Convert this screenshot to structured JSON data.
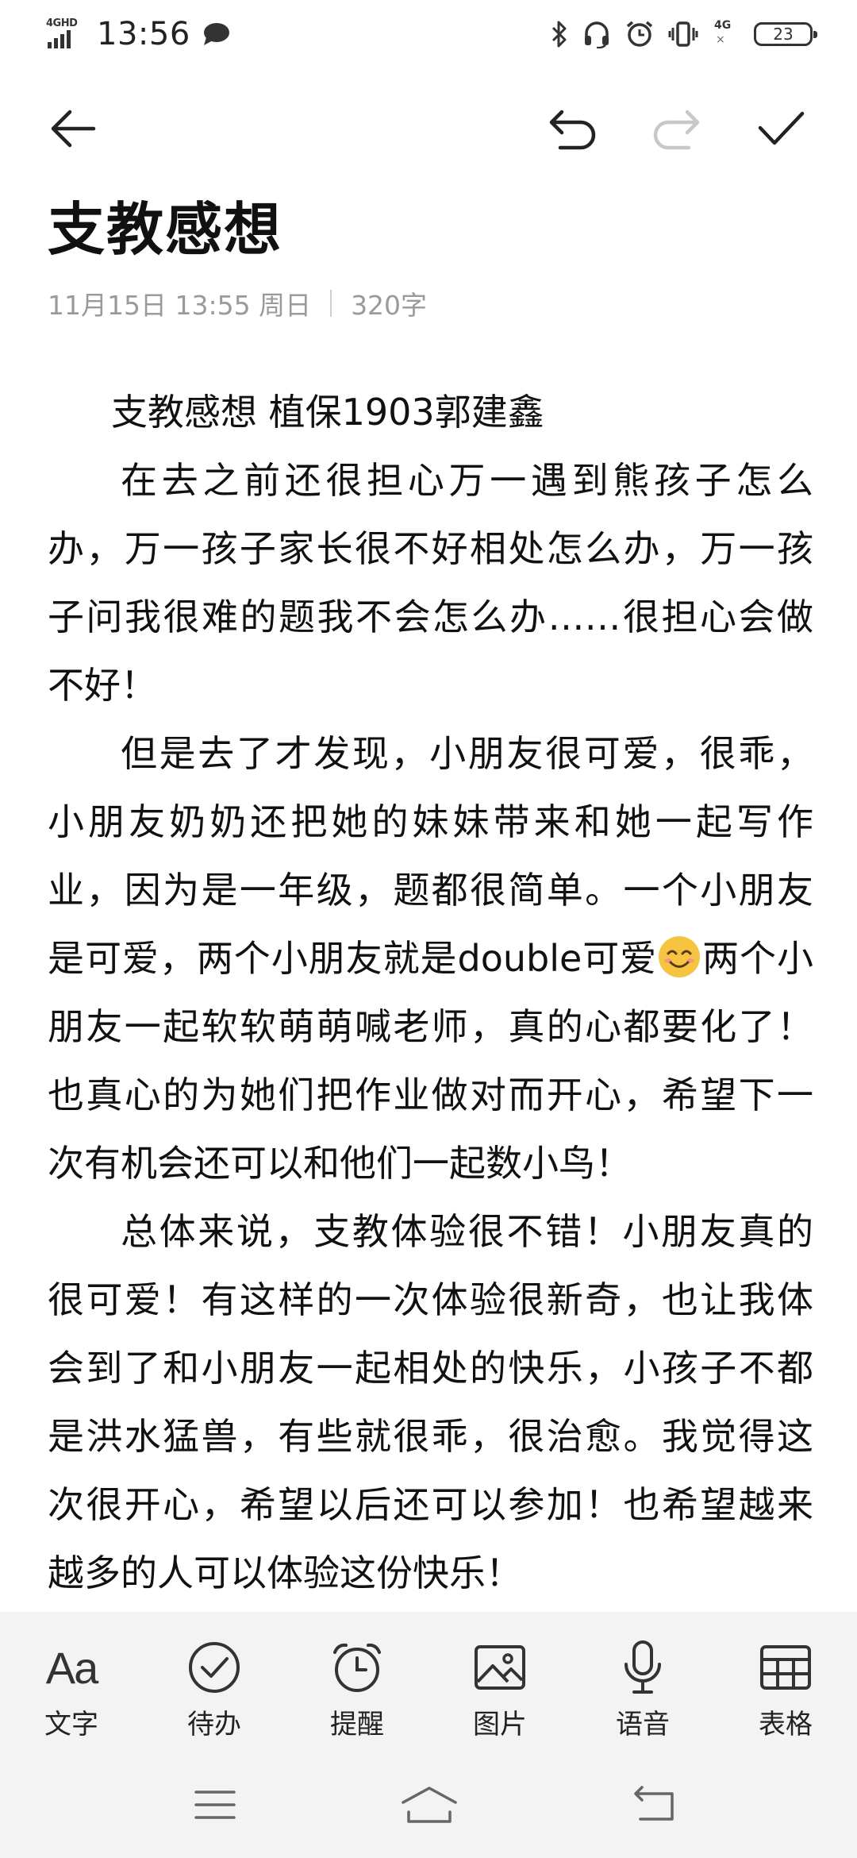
{
  "status_bar": {
    "network": "4GHD",
    "time": "13:56",
    "network2": "4G",
    "battery": "23"
  },
  "note": {
    "title": "支教感想",
    "date": "11月15日 13:55 周日",
    "word_count": "320字",
    "paragraphs": [
      "支教感想  植保1903郭建鑫",
      "在去之前还很担心万一遇到熊孩子怎么办，万一孩子家长很不好相处怎么办，万一孩子问我很难的题我不会怎么办……很担心会做不好！",
      "但是去了才发现，小朋友很可爱，很乖，小朋友奶奶还把她的妹妹带来和她一起写作业，因为是一年级，题都很简单。一个小朋友是可爱，两个小朋友就是double可爱",
      "两个小朋友一起软软萌萌喊老师，真的心都要化了！也真心的为她们把作业做对而开心，希望下一次有机会还可以和他们一起数小鸟！",
      "总体来说，支教体验很不错！小朋友真的很可爱！有这样的一次体验很新奇，也让我体会到了和小朋友一起相处的快乐，小孩子不都是洪水猛兽，有些就很乖，很治愈。我觉得这次很开心，希望以后还可以参加！也希望越来越多的人可以体验这份快乐！"
    ]
  },
  "toolbar": {
    "icons": [
      "back-arrow-icon",
      "undo-icon",
      "redo-icon",
      "check-icon"
    ]
  },
  "bottom_tools": [
    {
      "label": "文字",
      "icon": "text-format-icon",
      "glyph": "Aa"
    },
    {
      "label": "待办",
      "icon": "todo-check-icon"
    },
    {
      "label": "提醒",
      "icon": "alarm-clock-icon"
    },
    {
      "label": "图片",
      "icon": "image-icon"
    },
    {
      "label": "语音",
      "icon": "microphone-icon"
    },
    {
      "label": "表格",
      "icon": "table-icon"
    }
  ],
  "colors": {
    "meta_text": "#9a9a9a",
    "panel_bg": "#f3f3f3",
    "redo_disabled": "#c8c8c8"
  }
}
